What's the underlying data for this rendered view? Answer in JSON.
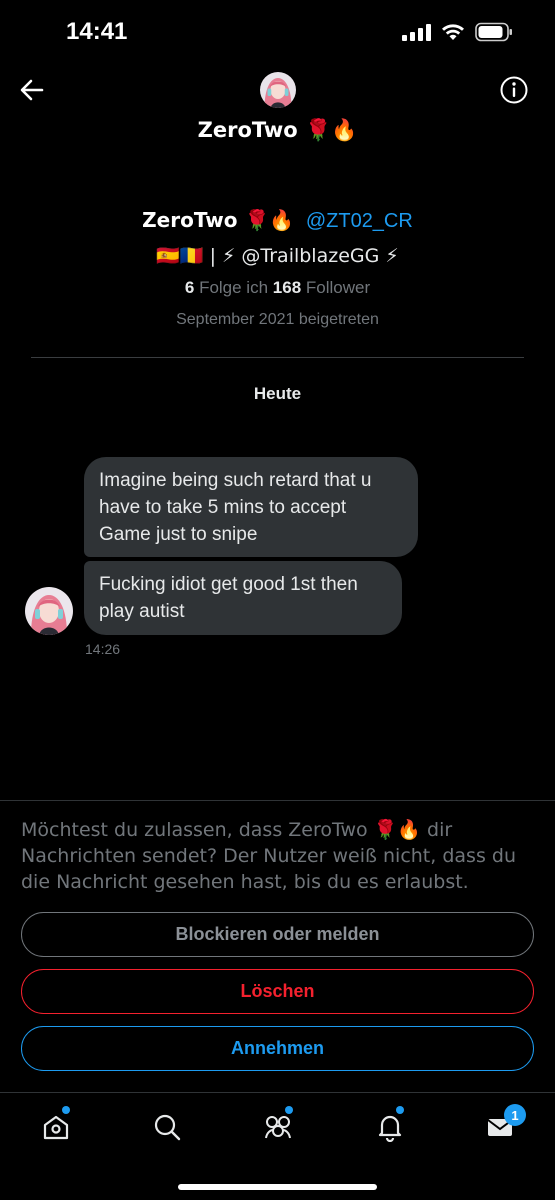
{
  "status_bar": {
    "time": "14:41"
  },
  "header": {
    "title": "ZeroTwo 🌹🔥",
    "back_icon": "arrow-left-icon",
    "info_icon": "info-icon"
  },
  "profile": {
    "name": "ZeroTwo 🌹🔥",
    "handle": "@ZT02_CR",
    "bio": "🇪🇸🇷🇴 | ⚡ @TrailblazeGG ⚡",
    "following_count": "6",
    "following_label": "Folge ich",
    "followers_count": "168",
    "followers_label": "Follower",
    "joined": "September 2021 beigetreten"
  },
  "conversation": {
    "day_label": "Heute",
    "messages": [
      {
        "text": "Imagine being such retard that u have to take 5 mins to accept Game just to snipe"
      },
      {
        "text": "Fucking idiot get good 1st then play autist"
      }
    ],
    "time": "14:26"
  },
  "request": {
    "text": "Möchtest du zulassen, dass ZeroTwo 🌹🔥 dir Nachrichten sendet? Der Nutzer weiß nicht, dass du die Nachricht gesehen hast, bis du es erlaubst.",
    "block_label": "Blockieren oder melden",
    "delete_label": "Löschen",
    "accept_label": "Annehmen"
  },
  "tab_bar": {
    "tabs": [
      "home-icon",
      "search-icon",
      "spaces-icon",
      "bell-icon",
      "mail-icon"
    ],
    "messages_badge": "1"
  },
  "colors": {
    "accent": "#1d9bf0",
    "danger": "#f4212e",
    "bubble": "#2f3336",
    "muted": "#71767b"
  }
}
